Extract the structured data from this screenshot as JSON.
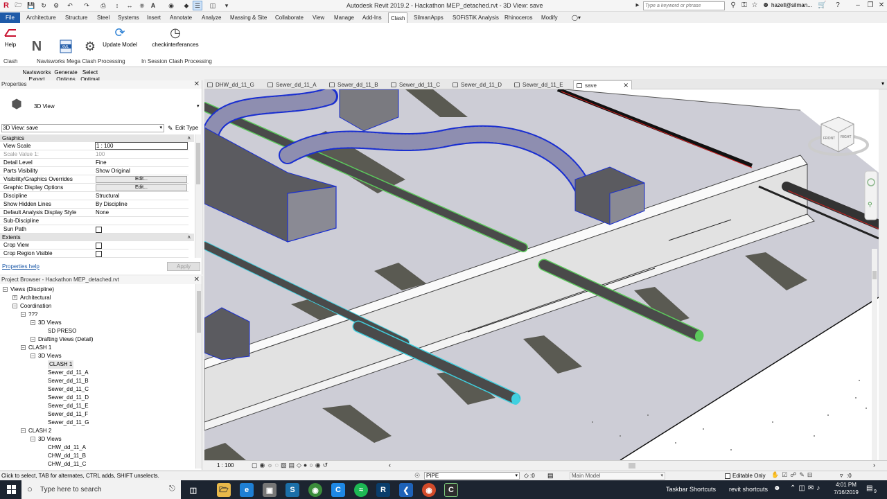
{
  "window": {
    "title": "Autodesk Revit 2019.2 - Hackathon MEP_detached.rvt - 3D View: save",
    "search_placeholder": "Type a keyword or phrase",
    "user": "hazell@silman..."
  },
  "menu": {
    "tabs": [
      "File",
      "Architecture",
      "Structure",
      "Steel",
      "Systems",
      "Insert",
      "Annotate",
      "Analyze",
      "Massing & Site",
      "Collaborate",
      "View",
      "Manage",
      "Add-Ins",
      "Clash",
      "SilmanApps",
      "SOFiSTiK Analysis",
      "Rhinoceros",
      "Modify"
    ],
    "active": "Clash"
  },
  "ribbon": {
    "buttons": [
      {
        "label": "Help"
      },
      {
        "label": "Navisworks\nExport"
      },
      {
        "label": "Generate\nOptions"
      },
      {
        "label": "Select\nOptimal"
      },
      {
        "label": "Update Model"
      },
      {
        "label": "checkinterferances"
      }
    ],
    "panels": [
      "Clash",
      "Navisworks Mega Clash Processing",
      "In Session Clash Processing"
    ]
  },
  "properties": {
    "title": "Properties",
    "type_name": "3D View",
    "instance_selector": "3D View: save",
    "edit_type": "Edit Type",
    "sections": {
      "graphics": "Graphics",
      "extents": "Extents"
    },
    "rows": [
      {
        "k": "View Scale",
        "v": "1 : 100"
      },
      {
        "k": "Scale Value    1:",
        "v": "100"
      },
      {
        "k": "Detail Level",
        "v": "Fine"
      },
      {
        "k": "Parts Visibility",
        "v": "Show Original"
      },
      {
        "k": "Visibility/Graphics Overrides",
        "v": "Edit..."
      },
      {
        "k": "Graphic Display Options",
        "v": "Edit..."
      },
      {
        "k": "Discipline",
        "v": "Structural"
      },
      {
        "k": "Show Hidden Lines",
        "v": "By Discipline"
      },
      {
        "k": "Default Analysis Display Style",
        "v": "None"
      },
      {
        "k": "Sub-Discipline",
        "v": ""
      },
      {
        "k": "Sun Path",
        "v": ""
      }
    ],
    "extents_rows": [
      {
        "k": "Crop View",
        "v": ""
      },
      {
        "k": "Crop Region Visible",
        "v": ""
      }
    ],
    "help_link": "Properties help",
    "apply": "Apply"
  },
  "browser": {
    "title": "Project Browser - Hackathon MEP_detached.rvt",
    "items": [
      {
        "label": "Views (Discipline)",
        "level": 0
      },
      {
        "label": "Architectural",
        "level": 1
      },
      {
        "label": "Coordination",
        "level": 1
      },
      {
        "label": "???",
        "level": 2
      },
      {
        "label": "3D Views",
        "level": 3
      },
      {
        "label": "SD PRESO",
        "level": 4
      },
      {
        "label": "Drafting Views (Detail)",
        "level": 3
      },
      {
        "label": "CLASH 1",
        "level": 2
      },
      {
        "label": "3D Views",
        "level": 3
      },
      {
        "label": "CLASH 1",
        "level": 4
      },
      {
        "label": "Sewer_dd_11_A",
        "level": 4
      },
      {
        "label": "Sewer_dd_11_B",
        "level": 4
      },
      {
        "label": "Sewer_dd_11_C",
        "level": 4
      },
      {
        "label": "Sewer_dd_11_D",
        "level": 4
      },
      {
        "label": "Sewer_dd_11_E",
        "level": 4
      },
      {
        "label": "Sewer_dd_11_F",
        "level": 4
      },
      {
        "label": "Sewer_dd_11_G",
        "level": 4
      },
      {
        "label": "CLASH 2",
        "level": 2
      },
      {
        "label": "3D Views",
        "level": 3
      },
      {
        "label": "CHW_dd_11_A",
        "level": 4
      },
      {
        "label": "CHW_dd_11_B",
        "level": 4
      },
      {
        "label": "CHW_dd_11_C",
        "level": 4
      }
    ]
  },
  "view_tabs": [
    "DHW_dd_11_G",
    "Sewer_dd_11_A",
    "Sewer_dd_11_B",
    "Sewer_dd_11_C",
    "Sewer_dd_11_D",
    "Sewer_dd_11_E",
    "save"
  ],
  "active_view_tab": "save",
  "viewcube": {
    "front": "FRONT",
    "right": "RIGHT"
  },
  "view_control": {
    "scale": "1 : 100"
  },
  "status": {
    "hint": "Click to select, TAB for alternates, CTRL adds, SHIFT unselects.",
    "workset": "PIPE",
    "count": ":0",
    "model": "Main Model",
    "editable_only": "Editable Only",
    "filter_count": ":0"
  },
  "taskbar": {
    "search_placeholder": "Type here to search",
    "shortcut1": "Taskbar Shortcuts",
    "shortcut2": "revit shortcuts",
    "time": "4:01 PM",
    "date": "7/16/2019",
    "notifications": "9"
  },
  "colors": {
    "accent": "#1e5aa8",
    "green_pipe": "#5cc95c",
    "cyan_pipe": "#3fd0e0",
    "duct_outline": "#1a2fd0"
  }
}
